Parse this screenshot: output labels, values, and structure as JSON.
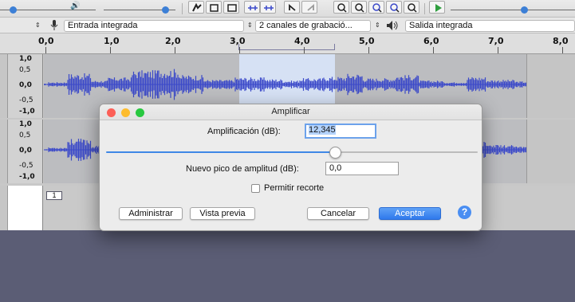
{
  "toolbar": {
    "selection_icons": [
      "selection-tool-icon",
      "envelope-tool-icon",
      "draw-tool-icon"
    ],
    "edit_icons": [
      "undo-icon",
      "redo-icon"
    ],
    "zoom_icons": [
      "zoom-in-icon",
      "zoom-out-icon",
      "fit-selection-icon",
      "fit-project-icon",
      "zoom-toggle-icon"
    ],
    "play_icon": "play-at-speed-icon"
  },
  "device_bar": {
    "input_device": "Entrada integrada",
    "channels": "2 canales de grabació...",
    "output_device": "Salida integrada",
    "mic_icon": "microphone-icon",
    "speaker_icon": "speaker-icon"
  },
  "ruler": {
    "labels": [
      "0,0",
      "1,0",
      "2,0",
      "3,0",
      "4,0",
      "5,0",
      "6,0",
      "7,0",
      "8,0"
    ]
  },
  "tracks": {
    "scale_labels": [
      "1,0",
      "0,5",
      "0,0",
      "-0,5",
      "-1,0"
    ],
    "label_text": "1"
  },
  "dialog": {
    "title": "Amplificar",
    "amplification_label": "Amplificación (dB):",
    "amplification_value": "12,345",
    "amplification_slider_level": 0.62,
    "peak_label": "Nuevo pico de amplitud (dB):",
    "peak_value": "0,0",
    "allow_clipping_label": "Permitir recorte",
    "allow_clipping_checked": false,
    "buttons": {
      "manage": "Administrar",
      "preview": "Vista previa",
      "cancel": "Cancelar",
      "ok": "Aceptar",
      "help": "?"
    }
  },
  "colors": {
    "waveform": "#3b49c9",
    "selection": "#d6e1f4",
    "accent": "#2f79ec",
    "background": "#5d5f78"
  }
}
